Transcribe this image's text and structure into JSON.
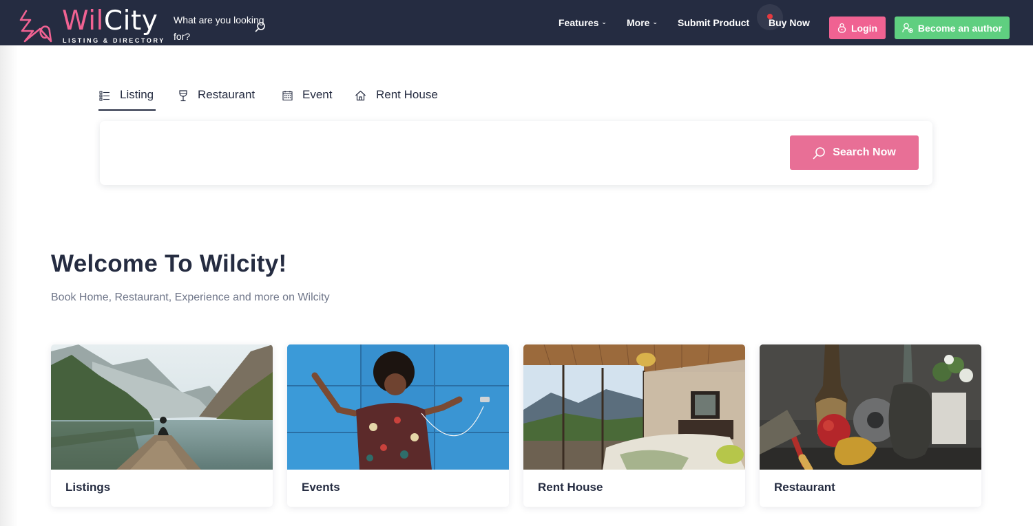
{
  "header": {
    "logo": {
      "word_a": "Wil",
      "word_b": "City",
      "tagline": "LISTING & DIRECTORY"
    },
    "search": {
      "placeholder": "What are you looking for?"
    },
    "nav": [
      {
        "label": "Features",
        "has_caret": true
      },
      {
        "label": "More",
        "has_caret": true
      },
      {
        "label": "Submit Product",
        "has_caret": false
      },
      {
        "label": "Buy Now",
        "has_caret": false
      }
    ],
    "login_label": "Login",
    "author_label": "Become an author",
    "colors": {
      "background": "#252c41",
      "brand_pink": "#f06292",
      "login": "#f06292",
      "author": "#5fcf80",
      "notification_dot": "#e5393f"
    }
  },
  "tabs": [
    {
      "label": "Listing",
      "icon": "list-icon",
      "active": true
    },
    {
      "label": "Restaurant",
      "icon": "wine-glass-icon",
      "active": false
    },
    {
      "label": "Event",
      "icon": "calendar-icon",
      "active": false
    },
    {
      "label": "Rent House",
      "icon": "home-icon",
      "active": false
    }
  ],
  "search_panel": {
    "button_label": "Search Now",
    "button_color": "#e86f96"
  },
  "welcome": {
    "title": "Welcome To Wilcity!",
    "subtitle": "Book Home, Restaurant, Experience and more on Wilcity"
  },
  "cards": [
    {
      "title": "Listings",
      "image": "mountain-lake-photo"
    },
    {
      "title": "Events",
      "image": "woman-dancing-photo"
    },
    {
      "title": "Rent House",
      "image": "bedroom-interior-photo"
    },
    {
      "title": "Restaurant",
      "image": "still-life-food-photo"
    }
  ]
}
